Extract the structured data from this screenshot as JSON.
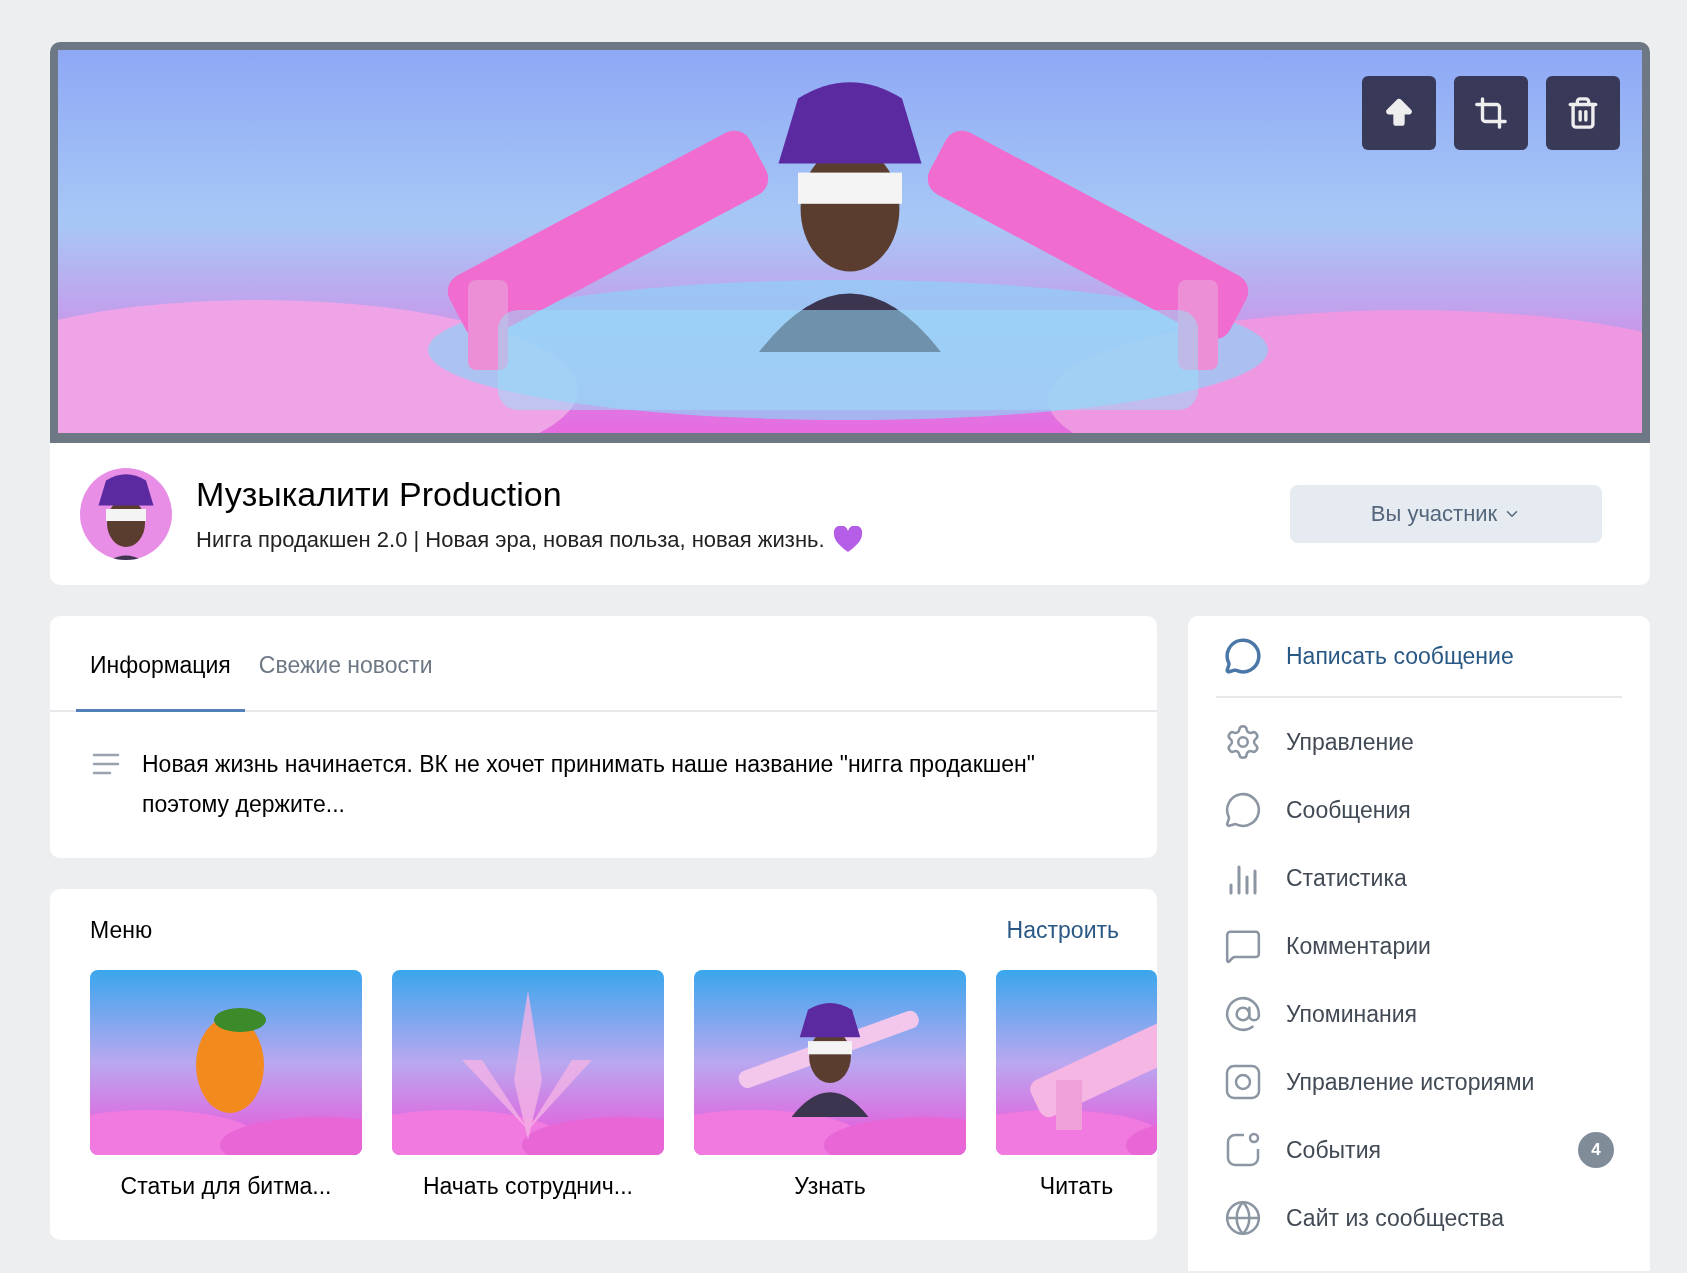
{
  "cover": {
    "kind": "picture",
    "actions": [
      {
        "kind": "upload"
      },
      {
        "kind": "crop"
      },
      {
        "kind": "delete"
      }
    ]
  },
  "header": {
    "title": "Музыкалити Production",
    "status": "Нигга продакшен 2.0 | Новая эра, новая польза, новая жизнь.",
    "member_button": "Вы участник"
  },
  "info": {
    "tabs": [
      {
        "label": "Информация",
        "selected": true
      },
      {
        "label": "Свежие новости",
        "selected": false
      }
    ],
    "description": "Новая жизнь начинается. ВК не хочет принимать наше название \"нигга продакшен\" поэтому держите..."
  },
  "menu": {
    "title": "Меню",
    "action": "Настроить",
    "items": [
      {
        "label": "Статьи для битма...",
        "kind": "picture"
      },
      {
        "label": "Начать сотруднич...",
        "kind": "picture"
      },
      {
        "label": "Узнать",
        "kind": "picture"
      },
      {
        "label": "Читать",
        "kind": "picture"
      }
    ]
  },
  "actions": {
    "primary": "Написать сообщение",
    "items": [
      {
        "label": "Управление"
      },
      {
        "label": "Сообщения"
      },
      {
        "label": "Статистика"
      },
      {
        "label": "Комментарии"
      },
      {
        "label": "Упоминания"
      },
      {
        "label": "Управление историями"
      },
      {
        "label": "События",
        "badge": "4"
      },
      {
        "label": "Сайт из сообщества"
      }
    ]
  }
}
